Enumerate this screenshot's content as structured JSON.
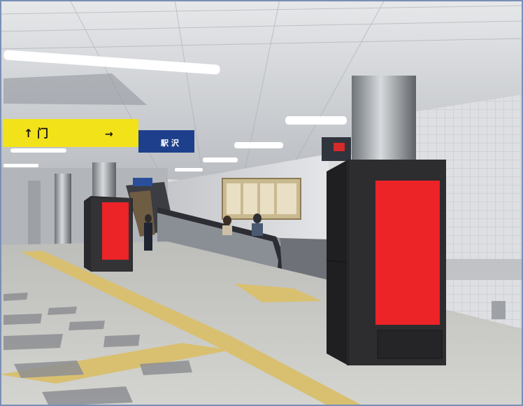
{
  "signs": {
    "yellow_sign_text": "↑ 门",
    "yellow_sign_arrow": "→",
    "blue_sign_text": "駅 沢"
  },
  "colors": {
    "ceiling": "#c9ccd0",
    "wall_tile": "#d9dade",
    "floor": "#c8c8c4",
    "tactile_paving": "#d8c070",
    "kiosk_body": "#2a2a2c",
    "screen": "#ec2327",
    "yellow_sign": "#f2e21a",
    "blue_sign": "#1e3f8c"
  }
}
